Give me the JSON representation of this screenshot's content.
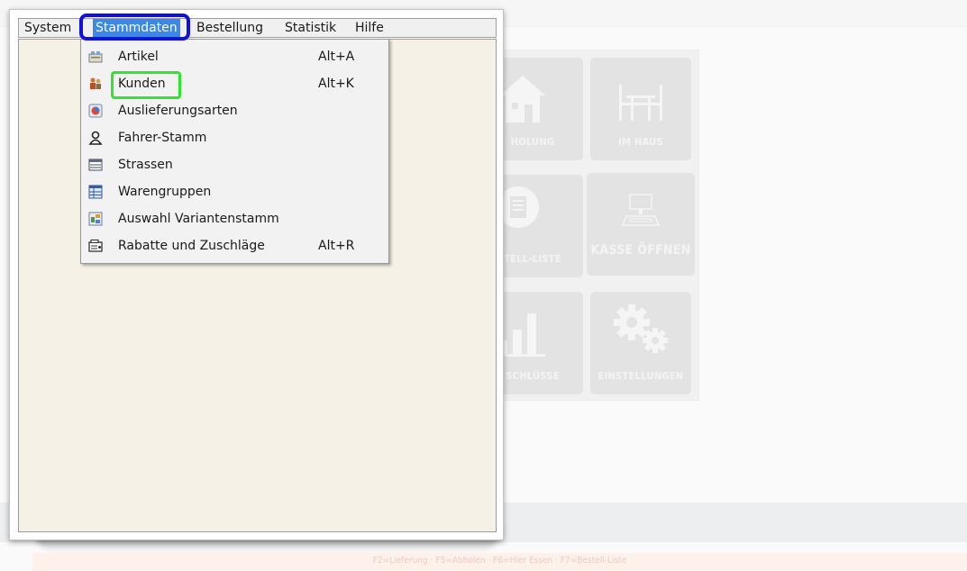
{
  "menubar": {
    "items": [
      {
        "label": "System"
      },
      {
        "label": "Stammdaten"
      },
      {
        "label": "Bestellung"
      },
      {
        "label": "Statistik"
      },
      {
        "label": "Hilfe"
      }
    ]
  },
  "dropdown": {
    "items": [
      {
        "label": "Artikel",
        "shortcut": "Alt+A",
        "icon": "articles-icon"
      },
      {
        "label": "Kunden",
        "shortcut": "Alt+K",
        "icon": "customers-icon"
      },
      {
        "label": "Auslieferungsarten",
        "shortcut": "",
        "icon": "delivery-types-icon"
      },
      {
        "label": "Fahrer-Stamm",
        "shortcut": "",
        "icon": "driver-icon"
      },
      {
        "label": "Strassen",
        "shortcut": "",
        "icon": "streets-icon"
      },
      {
        "label": "Warengruppen",
        "shortcut": "",
        "icon": "product-groups-icon"
      },
      {
        "label": "Auswahl Variantenstamm",
        "shortcut": "",
        "icon": "variants-icon"
      },
      {
        "label": "Rabatte und Zuschläge",
        "shortcut": "Alt+R",
        "icon": "discounts-icon"
      }
    ]
  },
  "background": {
    "tiles": [
      {
        "label": "HOLUNG",
        "icon": "house-icon"
      },
      {
        "label": "IM HAUS",
        "icon": "table-icon"
      },
      {
        "label": "TELL-LISTE",
        "icon": "list-icon"
      },
      {
        "label": "KASSE ÖFFNEN",
        "icon": "register-icon"
      },
      {
        "label": "SCHLÜSSE",
        "icon": "bar-chart-icon"
      },
      {
        "label": "EINSTELLUNGEN",
        "icon": "gears-icon"
      }
    ],
    "hint": "F2=Lieferung · F5=Abholen · F6=Hier Essen · F7=Bestell-Liste"
  },
  "colors": {
    "menu_active": "#3b88e8",
    "highlight_blue": "#1010e0",
    "highlight_green": "#2ee82e",
    "client_bg": "#f6f1e6"
  }
}
